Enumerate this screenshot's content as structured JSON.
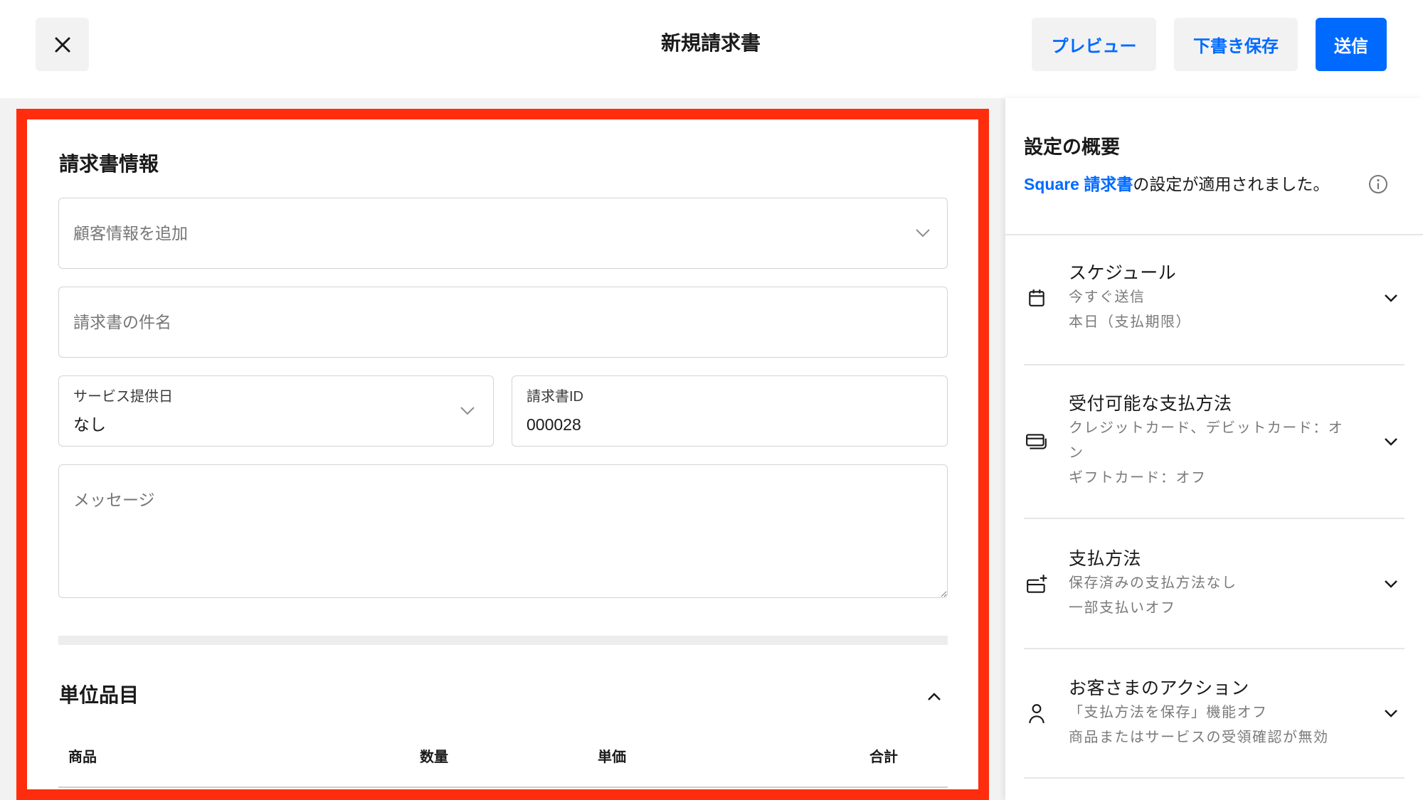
{
  "colors": {
    "accent": "#006aff",
    "highlight_border": "#ff2d0d"
  },
  "header": {
    "close_icon": "close-icon",
    "title": "新規請求書",
    "preview_label": "プレビュー",
    "save_draft_label": "下書き保存",
    "send_label": "送信"
  },
  "invoice_info": {
    "heading": "請求書情報",
    "customer": {
      "placeholder": "顧客情報を追加",
      "icon": "chevron-down-icon"
    },
    "subject": {
      "placeholder": "請求書の件名"
    },
    "service_date": {
      "label": "サービス提供日",
      "value": "なし",
      "icon": "chevron-down-icon"
    },
    "invoice_id": {
      "label": "請求書ID",
      "value": "000028"
    },
    "message": {
      "placeholder": "メッセージ"
    }
  },
  "line_items": {
    "heading": "単位品目",
    "collapse_icon": "chevron-up-icon",
    "columns": [
      "商品",
      "数量",
      "単価",
      "合計"
    ]
  },
  "settings": {
    "heading": "設定の概要",
    "notice_link": "Square 請求書",
    "notice_text": "の設定が適用されました。",
    "info_icon": "info-icon",
    "items": [
      {
        "icon": "calendar-icon",
        "title": "スケジュール",
        "lines": [
          "今すぐ送信",
          "本日（支払期限）"
        ]
      },
      {
        "icon": "cards-icon",
        "title": "受付可能な支払方法",
        "lines": [
          "クレジットカード、デビットカード：オン",
          "ギフトカード：オフ"
        ]
      },
      {
        "icon": "card-plus-icon",
        "title": "支払方法",
        "lines": [
          "保存済みの支払方法なし",
          "一部支払いオフ"
        ]
      },
      {
        "icon": "person-icon",
        "title": "お客さまのアクション",
        "lines": [
          "「支払方法を保存」機能オフ",
          "商品またはサービスの受領確認が無効"
        ]
      }
    ]
  }
}
